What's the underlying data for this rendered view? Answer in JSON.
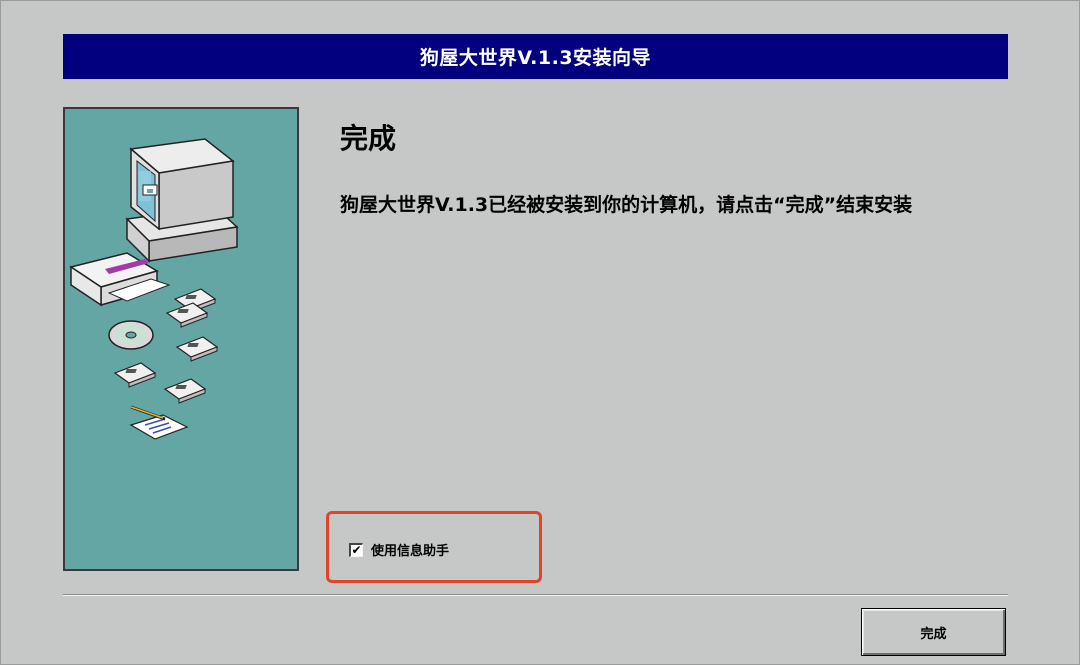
{
  "window": {
    "title": "狗屋大世界V.1.3安装向导"
  },
  "main": {
    "heading": "完成",
    "message": "狗屋大世界V.1.3已经被安装到你的计算机，请点击“完成”结束安装"
  },
  "options": {
    "assistant_checkbox_label": "使用信息助手",
    "assistant_checked": true,
    "check_mark": "✔"
  },
  "buttons": {
    "finish_label": "完成"
  },
  "colors": {
    "title_bar": "#02007e",
    "panel": "#64a6a4",
    "background": "#c6c8c8",
    "highlight": "#e0452b"
  },
  "illustration": {
    "icons": [
      "computer-icon",
      "software-box-icon",
      "cd-disc-icon",
      "floppy-disk-icon",
      "notepad-pen-icon"
    ]
  }
}
